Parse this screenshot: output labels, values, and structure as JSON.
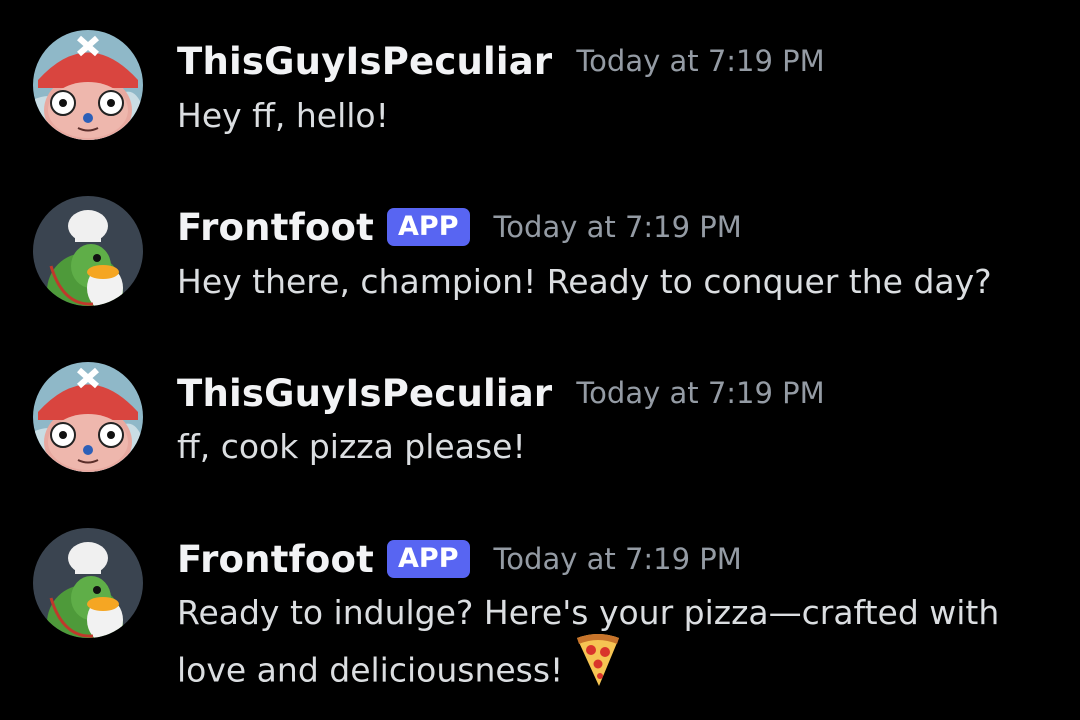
{
  "messages": [
    {
      "author": "ThisGuyIsPeculiar",
      "avatar_icon": "chopper-avatar",
      "is_app": false,
      "timestamp": "Today at 7:19 PM",
      "lines": [
        "Hey ff, hello!"
      ]
    },
    {
      "author": "Frontfoot",
      "avatar_icon": "chef-penguin-avatar",
      "is_app": true,
      "badge": "APP",
      "timestamp": "Today at 7:19 PM",
      "lines": [
        "Hey there, champion! Ready to conquer the day?"
      ]
    },
    {
      "author": "ThisGuyIsPeculiar",
      "avatar_icon": "chopper-avatar",
      "is_app": false,
      "timestamp": "Today at 7:19 PM",
      "lines": [
        "ff, cook pizza please!"
      ]
    },
    {
      "author": "Frontfoot",
      "avatar_icon": "chef-penguin-avatar",
      "is_app": true,
      "badge": "APP",
      "timestamp": "Today at 7:19 PM",
      "lines": [
        "Ready to indulge? Here's your pizza—crafted with",
        "love and deliciousness!"
      ],
      "emoji": "pizza-icon"
    }
  ],
  "colors": {
    "background": "#000000",
    "username": "#f2f3f5",
    "timestamp": "#949ba4",
    "message_text": "#dbdee1",
    "app_badge": "#5865f2"
  }
}
